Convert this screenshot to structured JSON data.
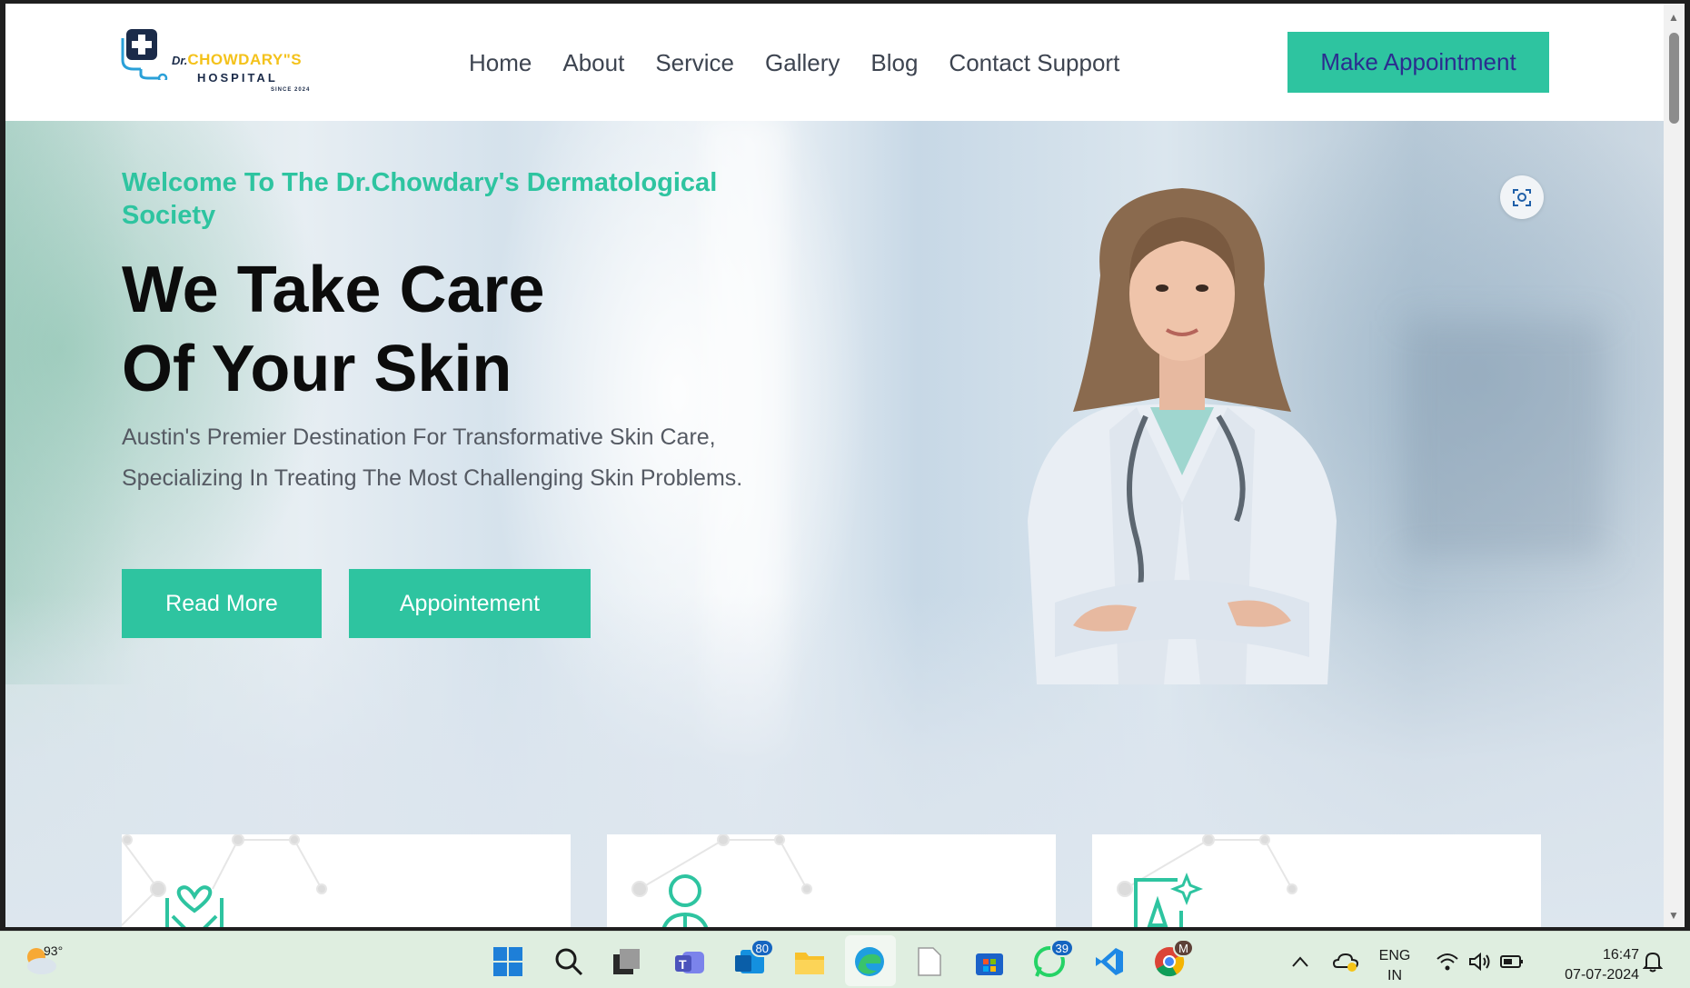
{
  "header": {
    "logo": {
      "dr": "Dr.",
      "name": "CHOWDARY\"S",
      "sub": "HOSPITAL",
      "since": "SINCE 2024"
    },
    "nav": [
      "Home",
      "About",
      "Service",
      "Gallery",
      "Blog",
      "Contact Support"
    ],
    "cta_label": "Make Appointment"
  },
  "hero": {
    "welcome": "Welcome To The Dr.Chowdary's Dermatological Society",
    "headline_line1": "We Take Care",
    "headline_line2": "Of Your Skin",
    "subtext": "Austin's Premier Destination For Transformative Skin Care, Specializing In Treating The Most Challenging Skin Problems.",
    "read_more_label": "Read More",
    "appointment_label": "Appointement"
  },
  "cards": [
    {
      "icon": "hands-heart-icon"
    },
    {
      "icon": "person-icon"
    },
    {
      "icon": "ai-icon"
    }
  ],
  "taskbar": {
    "weather_temp": "93°",
    "outlook_badge": "80",
    "whatsapp_badge": "39",
    "chrome_badge": "M",
    "language_line1": "ENG",
    "language_line2": "IN",
    "time": "16:47",
    "date": "07-07-2024"
  },
  "colors": {
    "accent": "#2ec4a0",
    "cta_text": "#2b2d8f",
    "heading": "#0c0c0c",
    "logo_yellow": "#f4c21b",
    "logo_navy": "#1b2b49"
  }
}
